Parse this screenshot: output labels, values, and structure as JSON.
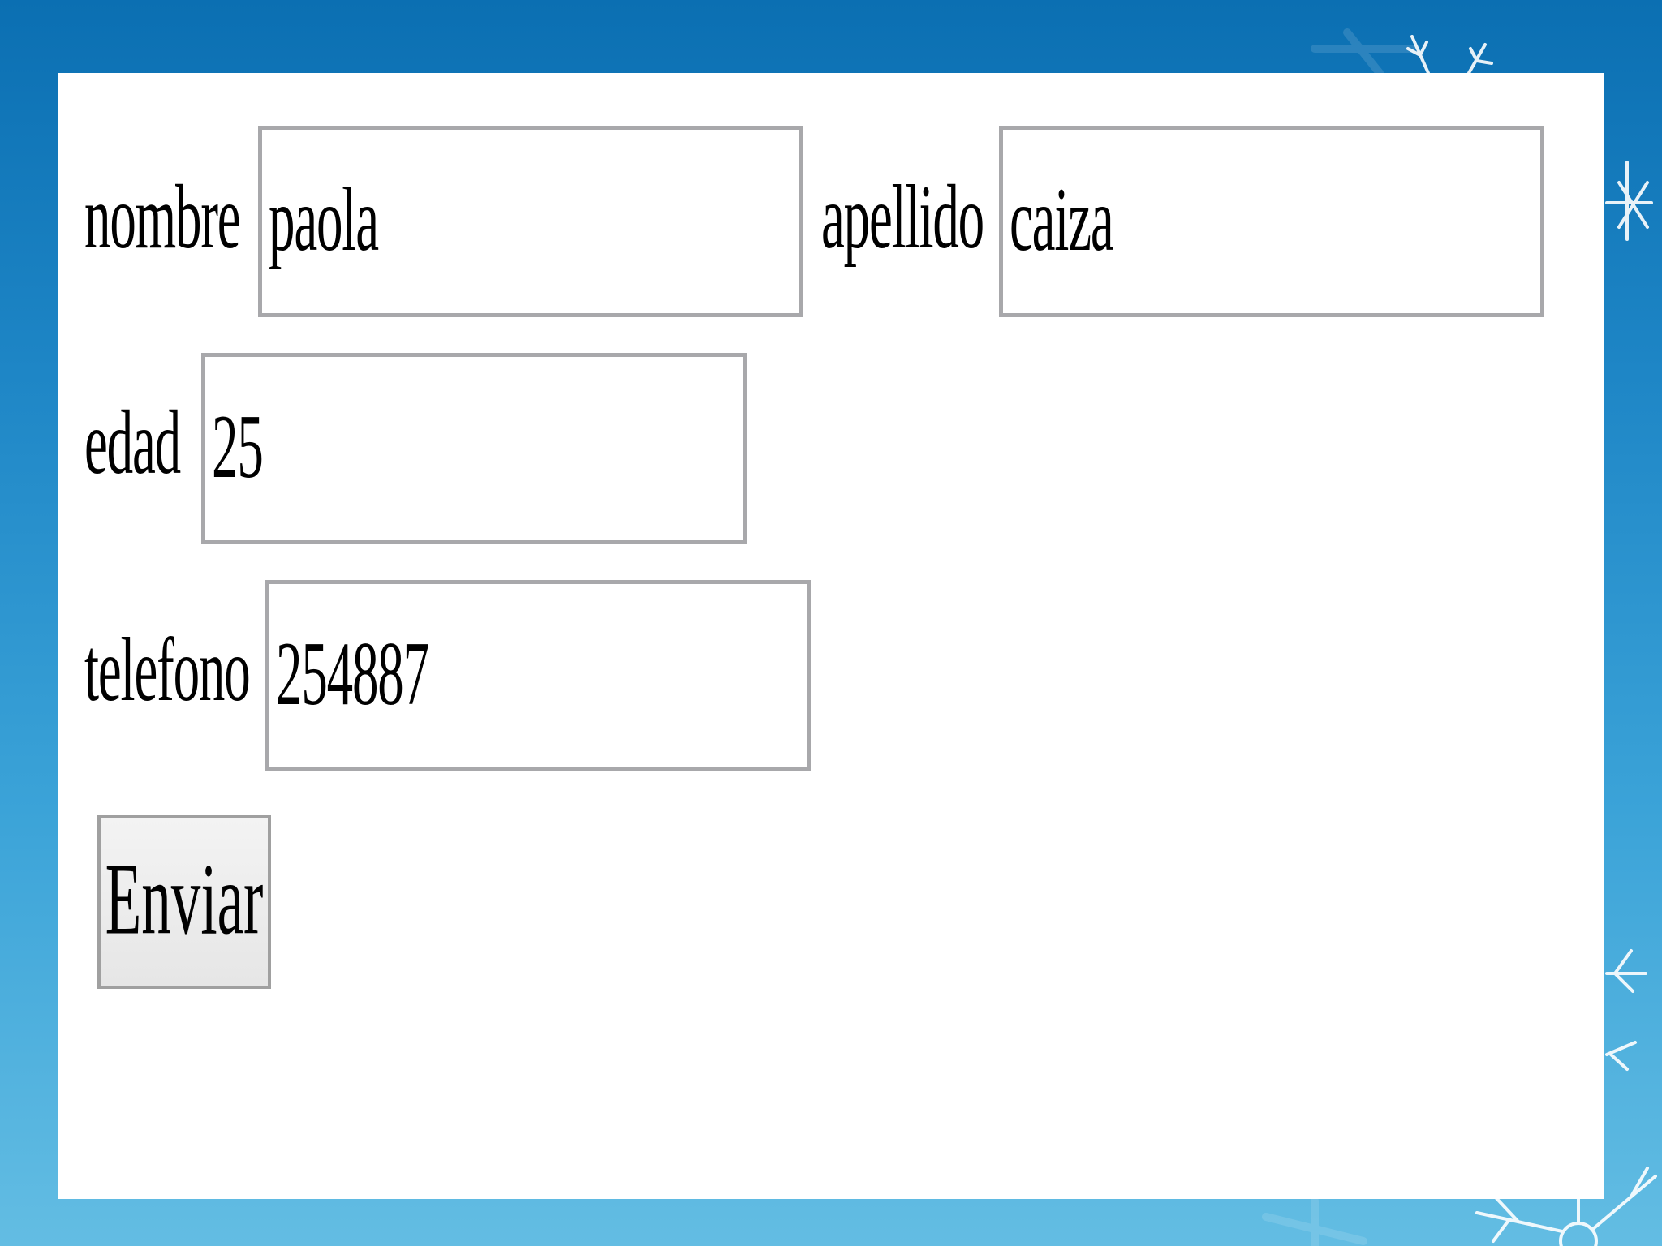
{
  "form": {
    "fields": [
      {
        "label": "nombre",
        "value": "paola"
      },
      {
        "label": "apellido",
        "value": "caiza"
      },
      {
        "label": "edad",
        "value": "25"
      },
      {
        "label": "telefono",
        "value": "254887"
      }
    ],
    "submit_label": "Enviar"
  },
  "colors": {
    "background_top": "#0b6fb2",
    "background_bottom": "#63bde3",
    "panel": "#ffffff",
    "input_border": "#a8a8ab",
    "button_face": "#ececec"
  },
  "decor": {
    "icon": "snowflake-icon"
  }
}
